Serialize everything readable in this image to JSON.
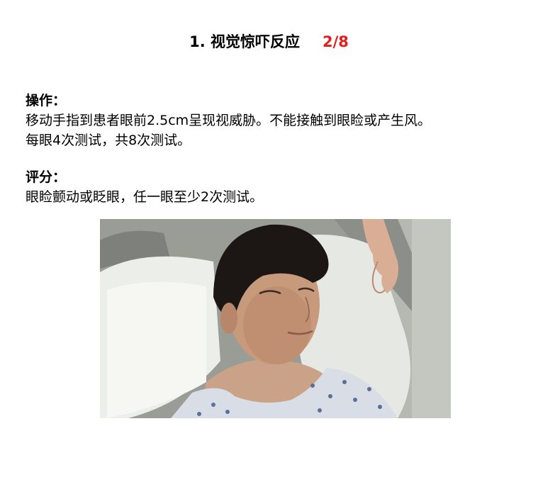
{
  "slide": {
    "title": "1. 视觉惊吓反应",
    "page_indicator": "2/8"
  },
  "operation": {
    "heading": "操作：",
    "lines": [
      "移动手指到患者眼前2.5cm呈现视威胁。不能接触到眼睑或产生风。",
      "每眼4次测试，共8次测试。"
    ]
  },
  "scoring": {
    "heading": "评分：",
    "lines": [
      "眼睑颤动或眨眼，任一眼至少2次测试。"
    ]
  },
  "colors": {
    "title_text": "#000000",
    "page_indicator": "#e0201c"
  }
}
